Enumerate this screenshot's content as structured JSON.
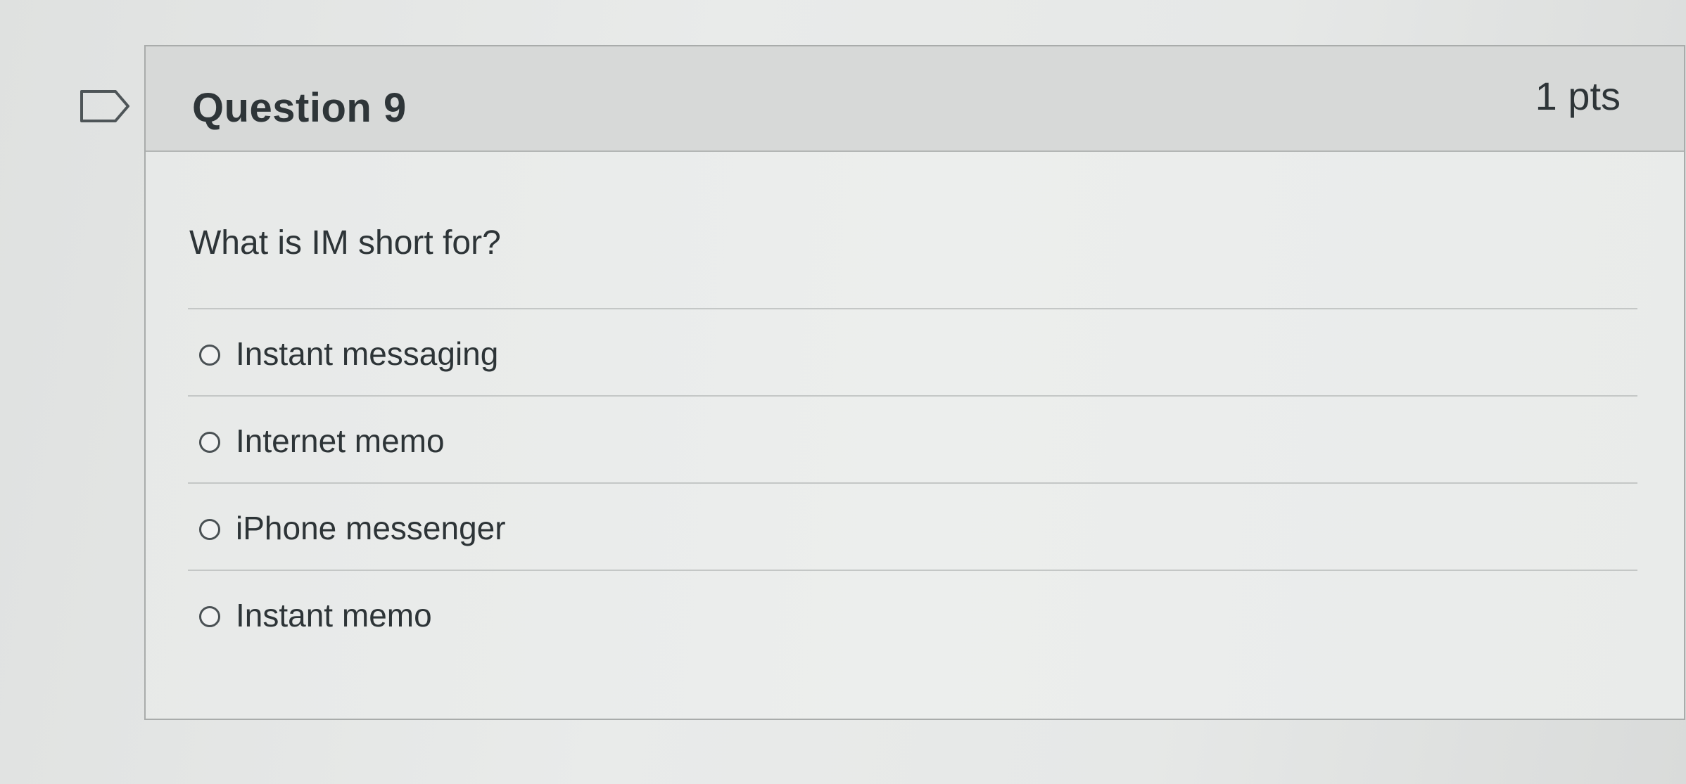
{
  "question": {
    "title": "Question 9",
    "points": "1 pts",
    "text": "What is IM short for?",
    "answers": [
      {
        "label": "Instant messaging"
      },
      {
        "label": "Internet memo"
      },
      {
        "label": "iPhone messenger"
      },
      {
        "label": "Instant memo"
      }
    ]
  },
  "icons": {
    "flag": "flag-question-icon",
    "radio": "radio-unselected"
  },
  "colors": {
    "text": "#2e3538",
    "header_bg": "#d7d9d8",
    "card_border": "#a9acab"
  }
}
